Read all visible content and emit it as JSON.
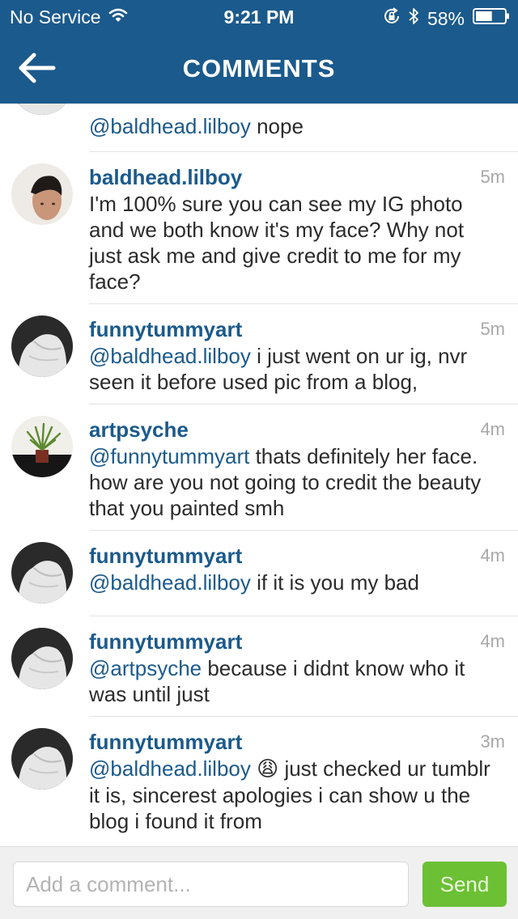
{
  "status_bar": {
    "carrier": "No Service",
    "time": "9:21 PM",
    "battery": "58%",
    "battery_level": 0.58,
    "icons": [
      "wifi-icon",
      "rotation-lock-icon",
      "bluetooth-icon",
      "battery-icon"
    ]
  },
  "nav": {
    "title": "COMMENTS",
    "back_icon": "back-arrow-icon"
  },
  "comments": [
    {
      "username": "",
      "timestamp": "",
      "mention": "@baldhead.lilboy",
      "text": " nope",
      "avatar": "funnytummyart-avatar"
    },
    {
      "username": "baldhead.lilboy",
      "timestamp": "5m",
      "mention": "",
      "text": "I'm 100% sure you can see my IG photo and we both know it's my face? Why not just ask me and give credit to me for my face?",
      "avatar": "baldhead-avatar"
    },
    {
      "username": "funnytummyart",
      "timestamp": "5m",
      "mention": "@baldhead.lilboy",
      "text": " i just went on ur ig, nvr seen it before used pic from a blog,",
      "avatar": "funnytummyart-avatar"
    },
    {
      "username": "artpsyche",
      "timestamp": "4m",
      "mention": "@funnytummyart",
      "text": " thats definitely her face. how are you not going to credit the beauty that you painted smh",
      "avatar": "artpsyche-avatar"
    },
    {
      "username": "funnytummyart",
      "timestamp": "4m",
      "mention": "@baldhead.lilboy",
      "text": " if it is you my bad",
      "avatar": "funnytummyart-avatar"
    },
    {
      "username": "funnytummyart",
      "timestamp": "4m",
      "mention": "@artpsyche",
      "text": " because i didnt know who it was until just",
      "avatar": "funnytummyart-avatar"
    },
    {
      "username": "funnytummyart",
      "timestamp": "3m",
      "mention": "@baldhead.lilboy",
      "emoji": "😩",
      "text": " just checked ur tumblr it is, sincerest apologies i can show u the blog i found it from",
      "avatar": "funnytummyart-avatar"
    }
  ],
  "input": {
    "placeholder": "Add a comment...",
    "value": "",
    "send_label": "Send"
  },
  "colors": {
    "header": "#1b5a8c",
    "username": "#1b5a8c",
    "send_button": "#6cc034",
    "timestamp": "#a8a8a8"
  }
}
